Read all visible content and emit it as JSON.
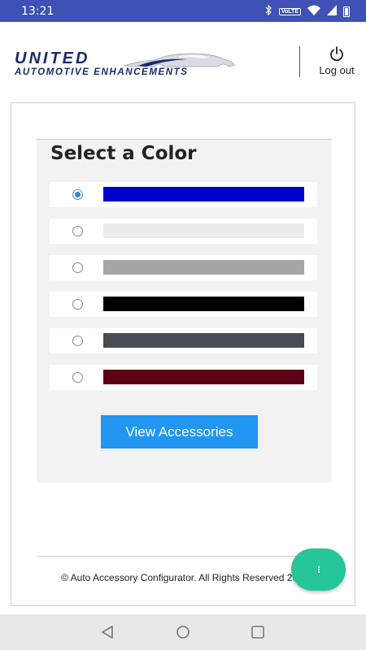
{
  "status_bar": {
    "time": "13:21",
    "volte": "VoLTE",
    "icons": [
      "bluetooth-icon",
      "wifi-icon",
      "signal-icon",
      "battery-icon"
    ]
  },
  "header": {
    "logo_top": "UNITED",
    "logo_bottom": "AUTOMOTIVE ENHANCEMENTS",
    "logout_label": "Log out",
    "logout_icon": "power-icon"
  },
  "panel": {
    "title": "Select a Color",
    "selected_index": 0,
    "colors": [
      "#0000c8",
      "#ebebeb",
      "#a6a6a6",
      "#000000",
      "#4a4b53",
      "#5c0013"
    ]
  },
  "button": {
    "label": "View Accessories"
  },
  "footer": {
    "text": "© Auto Accessory Configurator. All Rights Reserved 2020."
  },
  "fab": {
    "icon": "more-vert-icon"
  },
  "nav": {
    "icons": [
      "back-icon",
      "home-icon",
      "recents-icon"
    ]
  }
}
